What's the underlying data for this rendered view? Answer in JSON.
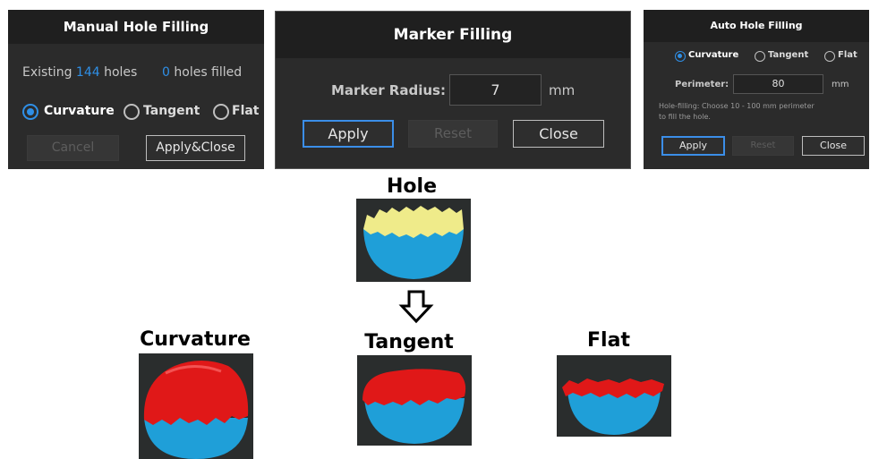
{
  "manual": {
    "title": "Manual Hole Filling",
    "existing_label": "Existing",
    "existing_count": "144",
    "holes_word": "holes",
    "filled_count": "0",
    "filled_label": "holes filled",
    "options": [
      "Curvature",
      "Tangent",
      "Flat"
    ],
    "selected": "Curvature",
    "cancel_label": "Cancel",
    "apply_close_label": "Apply&Close"
  },
  "marker": {
    "title": "Marker Filling",
    "radius_label": "Marker Radius:",
    "radius_value": "7",
    "unit": "mm",
    "apply_label": "Apply",
    "reset_label": "Reset",
    "close_label": "Close"
  },
  "auto": {
    "title": "Auto Hole Filling",
    "options": [
      "Curvature",
      "Tangent",
      "Flat"
    ],
    "selected": "Curvature",
    "perimeter_label": "Perimeter:",
    "perimeter_value": "80",
    "unit": "mm",
    "hint_line1": "Hole-filling:  Choose 10 - 100 mm perimeter",
    "hint_line2": "to fill the hole.",
    "apply_label": "Apply",
    "reset_label": "Reset",
    "close_label": "Close"
  },
  "illustration": {
    "hole_title": "Hole",
    "curvature_title": "Curvature",
    "tangent_title": "Tangent",
    "flat_title": "Flat"
  },
  "colors": {
    "panel_bg": "#2b2b2b",
    "accent_blue": "#2f8fe6",
    "fill_red": "#e01818",
    "hole_yellow": "#efeb8a",
    "hemisphere_blue": "#1f9fd8"
  },
  "icons": [
    "radio-icon",
    "down-arrow-icon"
  ]
}
